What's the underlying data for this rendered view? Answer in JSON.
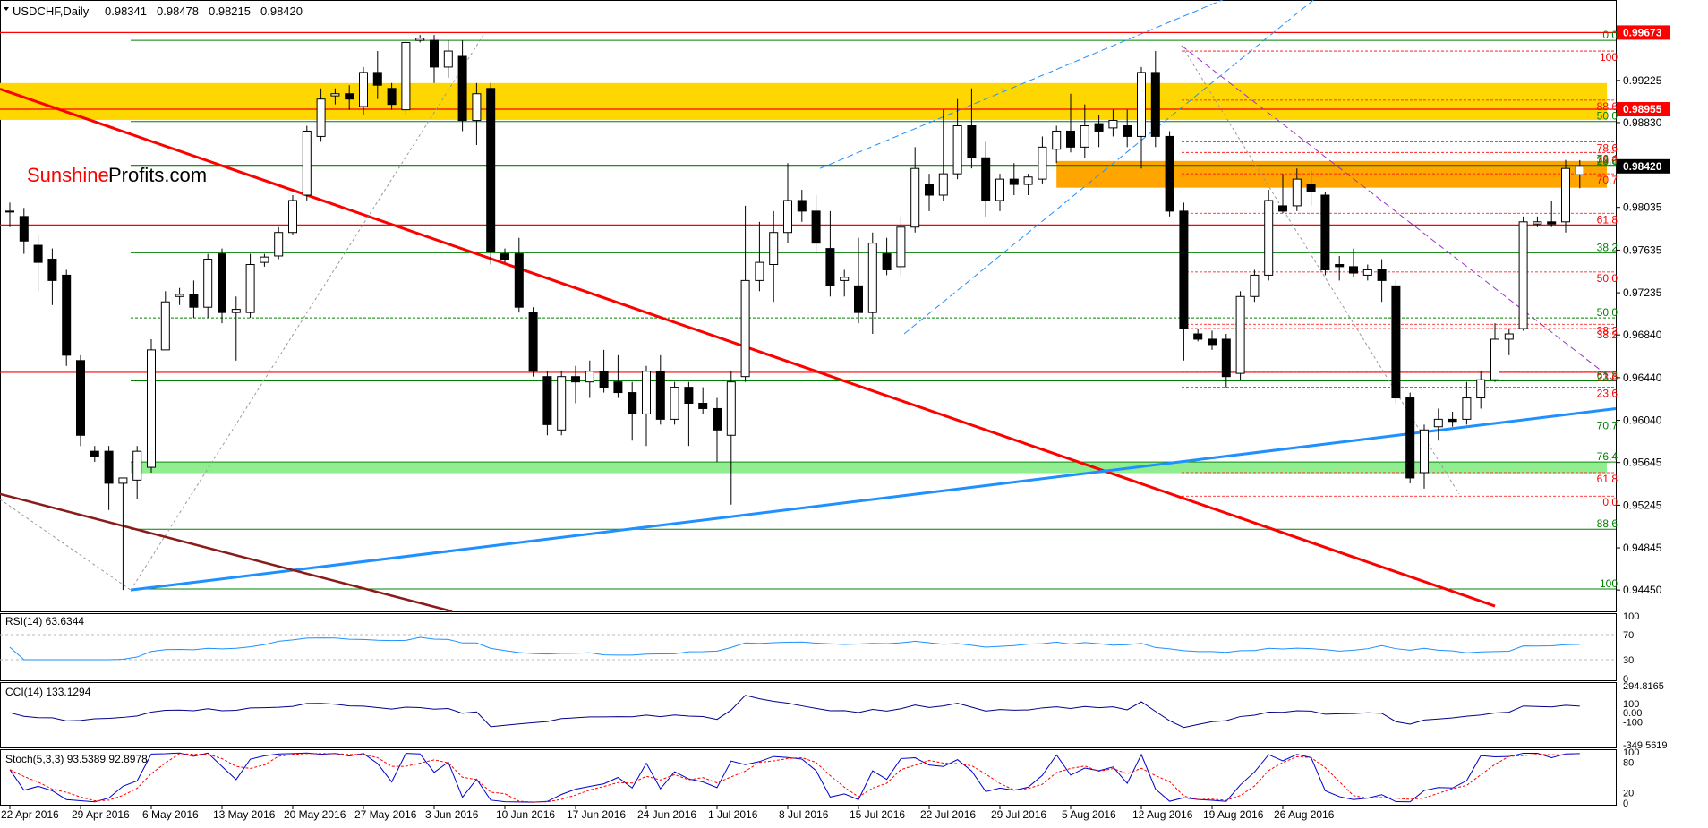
{
  "chart_data": {
    "type": "candlestick",
    "symbol": "USDCHF",
    "timeframe": "Daily",
    "header": {
      "title": "USDCHF,Daily",
      "open": "0.98341",
      "high": "0.98478",
      "low": "0.98215",
      "close": "0.98420"
    },
    "watermark": {
      "part1": "Sunshine",
      "part2": "Profits.com"
    },
    "price_axis": {
      "range": [
        0.9425,
        0.9997
      ],
      "ticks": [
        "0.99225",
        "0.98830",
        "0.98035",
        "0.97635",
        "0.97235",
        "0.96840",
        "0.96440",
        "0.96040",
        "0.95645",
        "0.95245",
        "0.94845",
        "0.94450"
      ],
      "highlight_labels": [
        {
          "text": "0.99673",
          "value": 0.99673,
          "color": "#ff0000"
        },
        {
          "text": "0.98955",
          "value": 0.98955,
          "color": "#ff0000"
        },
        {
          "text": "0.98420",
          "value": 0.9842,
          "color": "#000000"
        }
      ]
    },
    "date_axis": [
      "22 Apr 2016",
      "29 Apr 2016",
      "6 May 2016",
      "13 May 2016",
      "20 May 2016",
      "27 May 2016",
      "3 Jun 2016",
      "10 Jun 2016",
      "17 Jun 2016",
      "24 Jun 2016",
      "1 Jul 2016",
      "8 Jul 2016",
      "15 Jul 2016",
      "22 Jul 2016",
      "29 Jul 2016",
      "5 Aug 2016",
      "12 Aug 2016",
      "19 Aug 2016",
      "26 Aug 2016"
    ],
    "candles": [
      {
        "o": 0.98,
        "h": 0.9808,
        "l": 0.9785,
        "c": 0.98
      },
      {
        "o": 0.9795,
        "h": 0.9803,
        "l": 0.976,
        "c": 0.9772
      },
      {
        "o": 0.9768,
        "h": 0.9778,
        "l": 0.9725,
        "c": 0.9752
      },
      {
        "o": 0.9755,
        "h": 0.9765,
        "l": 0.9712,
        "c": 0.9735
      },
      {
        "o": 0.974,
        "h": 0.9745,
        "l": 0.9655,
        "c": 0.9665
      },
      {
        "o": 0.966,
        "h": 0.9665,
        "l": 0.958,
        "c": 0.959
      },
      {
        "o": 0.9575,
        "h": 0.958,
        "l": 0.9565,
        "c": 0.957
      },
      {
        "o": 0.9575,
        "h": 0.958,
        "l": 0.952,
        "c": 0.9545
      },
      {
        "o": 0.9545,
        "h": 0.955,
        "l": 0.9445,
        "c": 0.955
      },
      {
        "o": 0.9548,
        "h": 0.958,
        "l": 0.953,
        "c": 0.9575
      },
      {
        "o": 0.956,
        "h": 0.968,
        "l": 0.9555,
        "c": 0.967
      },
      {
        "o": 0.967,
        "h": 0.9725,
        "l": 0.967,
        "c": 0.9715
      },
      {
        "o": 0.972,
        "h": 0.9728,
        "l": 0.9712,
        "c": 0.9722
      },
      {
        "o": 0.9722,
        "h": 0.9735,
        "l": 0.97,
        "c": 0.971
      },
      {
        "o": 0.971,
        "h": 0.976,
        "l": 0.97,
        "c": 0.9755
      },
      {
        "o": 0.976,
        "h": 0.9765,
        "l": 0.9695,
        "c": 0.9705
      },
      {
        "o": 0.9705,
        "h": 0.972,
        "l": 0.966,
        "c": 0.9708
      },
      {
        "o": 0.9705,
        "h": 0.976,
        "l": 0.97,
        "c": 0.975
      },
      {
        "o": 0.9752,
        "h": 0.976,
        "l": 0.9748,
        "c": 0.9757
      },
      {
        "o": 0.9758,
        "h": 0.9785,
        "l": 0.9755,
        "c": 0.978
      },
      {
        "o": 0.978,
        "h": 0.9815,
        "l": 0.9778,
        "c": 0.981
      },
      {
        "o": 0.9815,
        "h": 0.988,
        "l": 0.981,
        "c": 0.9875
      },
      {
        "o": 0.987,
        "h": 0.9915,
        "l": 0.9865,
        "c": 0.9905
      },
      {
        "o": 0.9908,
        "h": 0.9915,
        "l": 0.99,
        "c": 0.991
      },
      {
        "o": 0.991,
        "h": 0.9918,
        "l": 0.9895,
        "c": 0.9905
      },
      {
        "o": 0.9898,
        "h": 0.9935,
        "l": 0.989,
        "c": 0.993
      },
      {
        "o": 0.993,
        "h": 0.995,
        "l": 0.9905,
        "c": 0.9918
      },
      {
        "o": 0.9915,
        "h": 0.992,
        "l": 0.9895,
        "c": 0.99
      },
      {
        "o": 0.9895,
        "h": 0.996,
        "l": 0.989,
        "c": 0.9958
      },
      {
        "o": 0.996,
        "h": 0.9965,
        "l": 0.9958,
        "c": 0.9962
      },
      {
        "o": 0.996,
        "h": 0.9965,
        "l": 0.992,
        "c": 0.9935
      },
      {
        "o": 0.9935,
        "h": 0.996,
        "l": 0.9925,
        "c": 0.995
      },
      {
        "o": 0.9945,
        "h": 0.996,
        "l": 0.9875,
        "c": 0.9885
      },
      {
        "o": 0.9885,
        "h": 0.992,
        "l": 0.9862,
        "c": 0.991
      },
      {
        "o": 0.9915,
        "h": 0.992,
        "l": 0.975,
        "c": 0.9762
      },
      {
        "o": 0.976,
        "h": 0.9765,
        "l": 0.9752,
        "c": 0.9755
      },
      {
        "o": 0.976,
        "h": 0.9775,
        "l": 0.9705,
        "c": 0.971
      },
      {
        "o": 0.9705,
        "h": 0.971,
        "l": 0.9645,
        "c": 0.965
      },
      {
        "o": 0.9645,
        "h": 0.965,
        "l": 0.959,
        "c": 0.96
      },
      {
        "o": 0.9595,
        "h": 0.965,
        "l": 0.959,
        "c": 0.9645
      },
      {
        "o": 0.9645,
        "h": 0.9655,
        "l": 0.962,
        "c": 0.964
      },
      {
        "o": 0.964,
        "h": 0.966,
        "l": 0.9625,
        "c": 0.965
      },
      {
        "o": 0.965,
        "h": 0.967,
        "l": 0.963,
        "c": 0.9635
      },
      {
        "o": 0.964,
        "h": 0.9665,
        "l": 0.9625,
        "c": 0.963
      },
      {
        "o": 0.963,
        "h": 0.964,
        "l": 0.9585,
        "c": 0.961
      },
      {
        "o": 0.961,
        "h": 0.9655,
        "l": 0.958,
        "c": 0.965
      },
      {
        "o": 0.965,
        "h": 0.9665,
        "l": 0.96,
        "c": 0.9605
      },
      {
        "o": 0.9605,
        "h": 0.964,
        "l": 0.96,
        "c": 0.9635
      },
      {
        "o": 0.9635,
        "h": 0.964,
        "l": 0.958,
        "c": 0.962
      },
      {
        "o": 0.962,
        "h": 0.9635,
        "l": 0.961,
        "c": 0.9615
      },
      {
        "o": 0.9615,
        "h": 0.9625,
        "l": 0.9565,
        "c": 0.9595
      },
      {
        "o": 0.959,
        "h": 0.965,
        "l": 0.9525,
        "c": 0.964
      },
      {
        "o": 0.9645,
        "h": 0.9805,
        "l": 0.964,
        "c": 0.9735
      },
      {
        "o": 0.9735,
        "h": 0.979,
        "l": 0.9725,
        "c": 0.9752
      },
      {
        "o": 0.975,
        "h": 0.98,
        "l": 0.9715,
        "c": 0.978
      },
      {
        "o": 0.978,
        "h": 0.9845,
        "l": 0.977,
        "c": 0.981
      },
      {
        "o": 0.981,
        "h": 0.982,
        "l": 0.979,
        "c": 0.98
      },
      {
        "o": 0.98,
        "h": 0.9815,
        "l": 0.976,
        "c": 0.977
      },
      {
        "o": 0.9765,
        "h": 0.98,
        "l": 0.972,
        "c": 0.973
      },
      {
        "o": 0.9735,
        "h": 0.9745,
        "l": 0.972,
        "c": 0.9738
      },
      {
        "o": 0.973,
        "h": 0.9775,
        "l": 0.9695,
        "c": 0.9705
      },
      {
        "o": 0.9705,
        "h": 0.978,
        "l": 0.9685,
        "c": 0.977
      },
      {
        "o": 0.976,
        "h": 0.9775,
        "l": 0.974,
        "c": 0.9745
      },
      {
        "o": 0.9748,
        "h": 0.9795,
        "l": 0.974,
        "c": 0.9785
      },
      {
        "o": 0.9785,
        "h": 0.986,
        "l": 0.978,
        "c": 0.984
      },
      {
        "o": 0.9825,
        "h": 0.9835,
        "l": 0.98,
        "c": 0.9815
      },
      {
        "o": 0.9815,
        "h": 0.9895,
        "l": 0.981,
        "c": 0.9835
      },
      {
        "o": 0.9835,
        "h": 0.9905,
        "l": 0.983,
        "c": 0.988
      },
      {
        "o": 0.988,
        "h": 0.9915,
        "l": 0.984,
        "c": 0.985
      },
      {
        "o": 0.985,
        "h": 0.9865,
        "l": 0.9795,
        "c": 0.981
      },
      {
        "o": 0.981,
        "h": 0.9835,
        "l": 0.98,
        "c": 0.983
      },
      {
        "o": 0.983,
        "h": 0.9845,
        "l": 0.9815,
        "c": 0.9825
      },
      {
        "o": 0.9825,
        "h": 0.9835,
        "l": 0.9815,
        "c": 0.9832
      },
      {
        "o": 0.983,
        "h": 0.987,
        "l": 0.9825,
        "c": 0.986
      },
      {
        "o": 0.9858,
        "h": 0.988,
        "l": 0.9845,
        "c": 0.9875
      },
      {
        "o": 0.9875,
        "h": 0.991,
        "l": 0.9855,
        "c": 0.986
      },
      {
        "o": 0.986,
        "h": 0.99,
        "l": 0.985,
        "c": 0.988
      },
      {
        "o": 0.9882,
        "h": 0.989,
        "l": 0.986,
        "c": 0.9875
      },
      {
        "o": 0.9878,
        "h": 0.9895,
        "l": 0.987,
        "c": 0.9885
      },
      {
        "o": 0.988,
        "h": 0.9895,
        "l": 0.986,
        "c": 0.987
      },
      {
        "o": 0.987,
        "h": 0.9935,
        "l": 0.984,
        "c": 0.993
      },
      {
        "o": 0.993,
        "h": 0.995,
        "l": 0.986,
        "c": 0.987
      },
      {
        "o": 0.987,
        "h": 0.9875,
        "l": 0.9795,
        "c": 0.98
      },
      {
        "o": 0.98,
        "h": 0.9808,
        "l": 0.966,
        "c": 0.969
      },
      {
        "o": 0.9685,
        "h": 0.969,
        "l": 0.9678,
        "c": 0.968
      },
      {
        "o": 0.968,
        "h": 0.9688,
        "l": 0.967,
        "c": 0.9675
      },
      {
        "o": 0.968,
        "h": 0.9685,
        "l": 0.9635,
        "c": 0.9645
      },
      {
        "o": 0.9648,
        "h": 0.9725,
        "l": 0.9642,
        "c": 0.972
      },
      {
        "o": 0.972,
        "h": 0.9745,
        "l": 0.9715,
        "c": 0.974
      },
      {
        "o": 0.974,
        "h": 0.982,
        "l": 0.9735,
        "c": 0.981
      },
      {
        "o": 0.9805,
        "h": 0.9835,
        "l": 0.9798,
        "c": 0.98
      },
      {
        "o": 0.9805,
        "h": 0.984,
        "l": 0.98,
        "c": 0.983
      },
      {
        "o": 0.9825,
        "h": 0.9838,
        "l": 0.9805,
        "c": 0.9818
      },
      {
        "o": 0.9815,
        "h": 0.9818,
        "l": 0.974,
        "c": 0.9745
      },
      {
        "o": 0.975,
        "h": 0.9758,
        "l": 0.9735,
        "c": 0.9748
      },
      {
        "o": 0.9748,
        "h": 0.9765,
        "l": 0.9738,
        "c": 0.9742
      },
      {
        "o": 0.974,
        "h": 0.975,
        "l": 0.9735,
        "c": 0.9745
      },
      {
        "o": 0.9745,
        "h": 0.9755,
        "l": 0.9715,
        "c": 0.9735
      },
      {
        "o": 0.973,
        "h": 0.9735,
        "l": 0.962,
        "c": 0.9625
      },
      {
        "o": 0.9625,
        "h": 0.963,
        "l": 0.9545,
        "c": 0.955
      },
      {
        "o": 0.9555,
        "h": 0.96,
        "l": 0.954,
        "c": 0.9595
      },
      {
        "o": 0.9598,
        "h": 0.9615,
        "l": 0.9585,
        "c": 0.9605
      },
      {
        "o": 0.9605,
        "h": 0.9612,
        "l": 0.9598,
        "c": 0.9603
      },
      {
        "o": 0.9605,
        "h": 0.964,
        "l": 0.96,
        "c": 0.9625
      },
      {
        "o": 0.9625,
        "h": 0.965,
        "l": 0.9615,
        "c": 0.9642
      },
      {
        "o": 0.9642,
        "h": 0.9695,
        "l": 0.964,
        "c": 0.968
      },
      {
        "o": 0.968,
        "h": 0.969,
        "l": 0.9665,
        "c": 0.9685
      },
      {
        "o": 0.969,
        "h": 0.9795,
        "l": 0.9688,
        "c": 0.979
      },
      {
        "o": 0.9788,
        "h": 0.9795,
        "l": 0.9785,
        "c": 0.979
      },
      {
        "o": 0.979,
        "h": 0.981,
        "l": 0.9785,
        "c": 0.9788
      },
      {
        "o": 0.979,
        "h": 0.9848,
        "l": 0.978,
        "c": 0.984
      },
      {
        "o": 0.98341,
        "h": 0.98478,
        "l": 0.98215,
        "c": 0.9842
      }
    ],
    "zones": [
      {
        "top": 0.992,
        "bottom": 0.98855,
        "color": "#ffd700"
      },
      {
        "top": 0.9847,
        "bottom": 0.9822,
        "color": "#ffa500"
      },
      {
        "top": 0.95645,
        "bottom": 0.95545,
        "color": "#90ee90"
      }
    ],
    "levels": [
      {
        "value": 0.99673,
        "color": "#ff0000",
        "dash": false
      },
      {
        "value": 0.98955,
        "color": "#ff0000",
        "dash": false
      },
      {
        "value": 0.9787,
        "color": "#ff0000",
        "dash": false
      },
      {
        "value": 0.9649,
        "color": "#ff0000",
        "dash": false
      }
    ],
    "fib_green_labels": [
      {
        "text": "0.0",
        "value": 0.996
      },
      {
        "text": "50.0",
        "value": 0.9884
      },
      {
        "text": "38.2",
        "value": 0.9843
      },
      {
        "text": "23.6",
        "value": 0.9842
      },
      {
        "text": "38.2",
        "value": 0.9761
      },
      {
        "text": "50.0",
        "value": 0.97
      },
      {
        "text": "61.8",
        "value": 0.9641
      },
      {
        "text": "70.7",
        "value": 0.9594
      },
      {
        "text": "76.4",
        "value": 0.9565
      },
      {
        "text": "88.6",
        "value": 0.9502
      },
      {
        "text": "100",
        "value": 0.9446
      }
    ],
    "fib_red_labels": [
      {
        "text": "100",
        "value": 0.995
      },
      {
        "text": "88.6",
        "value": 0.9904
      },
      {
        "text": "78.6",
        "value": 0.9865
      },
      {
        "text": "76.4",
        "value": 0.9855
      },
      {
        "text": "70.7",
        "value": 0.9835
      },
      {
        "text": "61.8",
        "value": 0.9798
      },
      {
        "text": "50.0",
        "value": 0.9743
      },
      {
        "text": "38.2",
        "value": 0.9694
      },
      {
        "text": "23.6",
        "value": 0.965
      },
      {
        "text": "0.0",
        "value": 0.9533
      },
      {
        "text": "61.8",
        "value": 0.9555
      },
      {
        "text": "38.2",
        "value": 0.969
      },
      {
        "text": "23.6",
        "value": 0.9635
      }
    ],
    "rsi": {
      "label": "RSI(14) 63.6344",
      "ticks": [
        "100",
        "70",
        "30",
        "0"
      ],
      "range": [
        0,
        100
      ],
      "levels": [
        70,
        30
      ]
    },
    "cci": {
      "label": "CCI(14) 133.1294",
      "ticks": [
        "294.8165",
        "100",
        "0.00",
        "-100",
        "-349.5619"
      ],
      "range": [
        -349.5619,
        294.8165
      ]
    },
    "stoch": {
      "label": "Stoch(5,3,3) 93.5389 92.8978",
      "ticks": [
        "100",
        "80",
        "20",
        "0"
      ],
      "range": [
        0,
        100
      ]
    },
    "colors": {
      "up_candle": "#ffffff",
      "down_candle": "#000000",
      "red_line": "#ff0000",
      "blue_line": "#1e90ff",
      "brown_line": "#8b1a1a",
      "green_line": "#008000",
      "purple_dashed": "#9932cc",
      "indicator_line": "#1e90ff",
      "cci_line": "#00008b",
      "stoch_main": "#0000cd",
      "stoch_signal": "#ff0000"
    }
  }
}
